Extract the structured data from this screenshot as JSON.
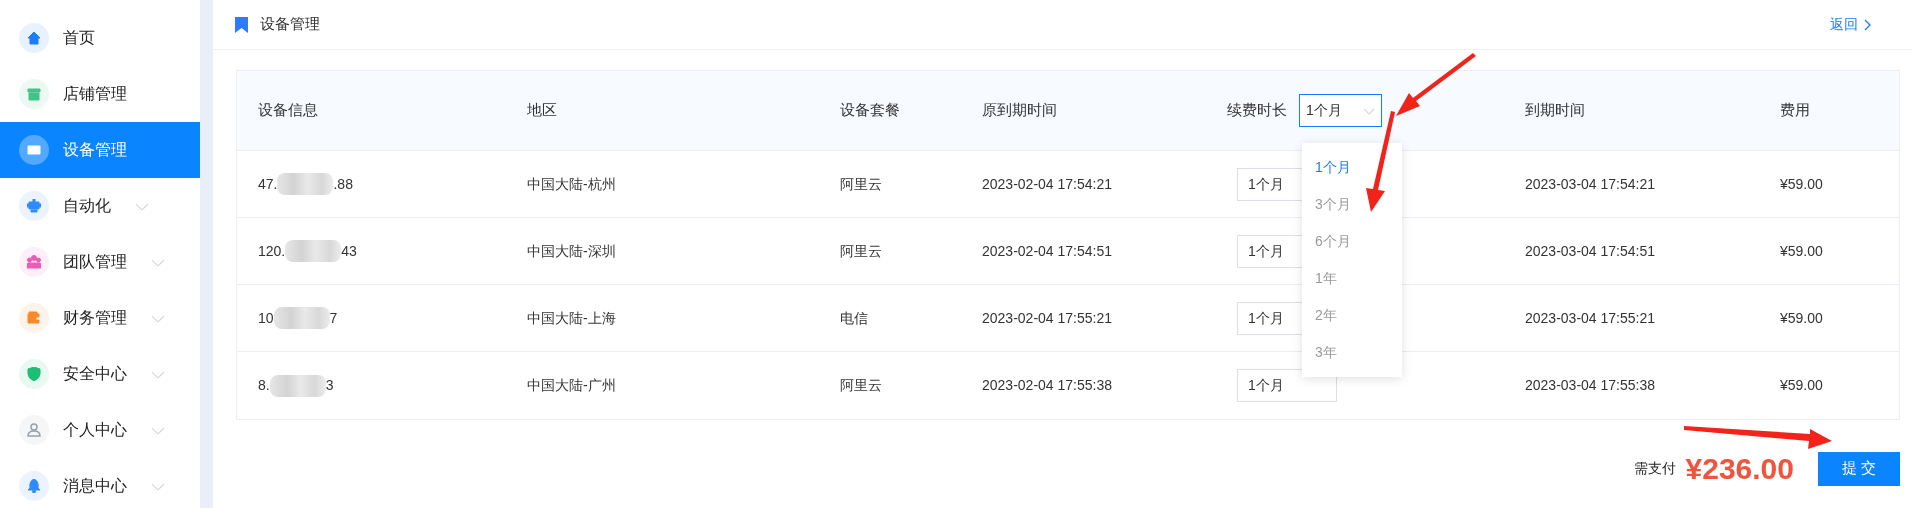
{
  "sidebar": {
    "items": [
      {
        "label": "首页",
        "selected": false,
        "expandable": false,
        "color": "#1a7cff"
      },
      {
        "label": "店铺管理",
        "selected": false,
        "expandable": false,
        "color": "#3fc58a"
      },
      {
        "label": "设备管理",
        "selected": true,
        "expandable": false
      },
      {
        "label": "自动化",
        "selected": false,
        "expandable": true,
        "color": "#2e8bff"
      },
      {
        "label": "团队管理",
        "selected": false,
        "expandable": true,
        "color": "#ef5ab8"
      },
      {
        "label": "财务管理",
        "selected": false,
        "expandable": true,
        "color": "#f98a2a"
      },
      {
        "label": "安全中心",
        "selected": false,
        "expandable": true,
        "color": "#1dbf73"
      },
      {
        "label": "个人中心",
        "selected": false,
        "expandable": true,
        "color": "#9aa0aa"
      },
      {
        "label": "消息中心",
        "selected": false,
        "expandable": true,
        "color": "#2e8bff"
      }
    ]
  },
  "header": {
    "title": "设备管理",
    "back_link": "返回"
  },
  "table": {
    "columns": [
      "设备信息",
      "地区",
      "设备套餐",
      "原到期时间",
      "续费时长",
      "到期时间",
      "费用"
    ],
    "renewal_select": {
      "value": "1个月",
      "expanded": true
    },
    "renewal_options": [
      {
        "label": "1个月",
        "selected": true
      },
      {
        "label": "3个月",
        "selected": false
      },
      {
        "label": "6个月",
        "selected": false
      },
      {
        "label": "1年",
        "selected": false
      },
      {
        "label": "2年",
        "selected": false
      },
      {
        "label": "3年",
        "selected": false
      }
    ],
    "rows": [
      {
        "ip_start": "47.",
        "ip_end": ".88",
        "region": "中国大陆-杭州",
        "package": "阿里云",
        "old_expiry": "2023-02-04 17:54:21",
        "duration": "1个月",
        "new_expiry": "2023-03-04 17:54:21",
        "fee": "¥59.00"
      },
      {
        "ip_start": "120.",
        "ip_end": "43",
        "region": "中国大陆-深圳",
        "package": "阿里云",
        "old_expiry": "2023-02-04 17:54:51",
        "duration": "1个月",
        "new_expiry": "2023-03-04 17:54:51",
        "fee": "¥59.00"
      },
      {
        "ip_start": "10",
        "ip_end": "7",
        "region": "中国大陆-上海",
        "package": "电信",
        "old_expiry": "2023-02-04 17:55:21",
        "duration": "1个月",
        "new_expiry": "2023-03-04 17:55:21",
        "fee": "¥59.00"
      },
      {
        "ip_start": "8.",
        "ip_end": "3",
        "region": "中国大陆-广州",
        "package": "阿里云",
        "old_expiry": "2023-02-04 17:55:38",
        "duration": "1个月",
        "new_expiry": "2023-03-04 17:55:38",
        "fee": "¥59.00"
      }
    ]
  },
  "footer": {
    "label": "需支付",
    "total": "¥236.00",
    "submit": "提 交"
  }
}
